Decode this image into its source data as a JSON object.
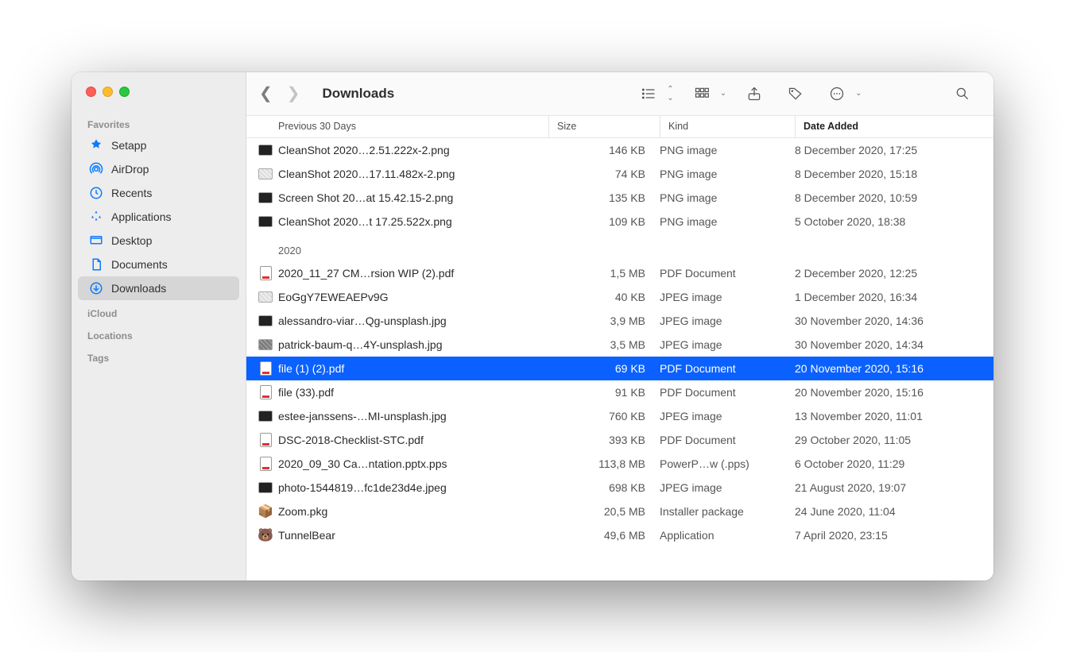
{
  "window": {
    "title": "Downloads"
  },
  "sidebar": {
    "sections": [
      {
        "label": "Favorites",
        "items": [
          {
            "icon": "setapp",
            "label": "Setapp"
          },
          {
            "icon": "airdrop",
            "label": "AirDrop"
          },
          {
            "icon": "recents",
            "label": "Recents"
          },
          {
            "icon": "apps",
            "label": "Applications"
          },
          {
            "icon": "desktop",
            "label": "Desktop"
          },
          {
            "icon": "docs",
            "label": "Documents"
          },
          {
            "icon": "downloads",
            "label": "Downloads",
            "active": true
          }
        ]
      },
      {
        "label": "iCloud",
        "items": []
      },
      {
        "label": "Locations",
        "items": []
      },
      {
        "label": "Tags",
        "items": []
      }
    ]
  },
  "columns": {
    "name": "Previous 30 Days",
    "size": "Size",
    "kind": "Kind",
    "date": "Date Added"
  },
  "groups": [
    {
      "label": null,
      "rows": [
        {
          "icon": "img-dark",
          "name": "CleanShot 2020…2.51.222x-2.png",
          "size": "146 KB",
          "kind": "PNG image",
          "date": "8 December 2020, 17:25"
        },
        {
          "icon": "img-light",
          "name": "CleanShot 2020…17.11.482x-2.png",
          "size": "74 KB",
          "kind": "PNG image",
          "date": "8 December 2020, 15:18"
        },
        {
          "icon": "img-dark",
          "name": "Screen Shot 20…at 15.42.15-2.png",
          "size": "135 KB",
          "kind": "PNG image",
          "date": "8 December 2020, 10:59"
        },
        {
          "icon": "img-dark",
          "name": "CleanShot 2020…t 17.25.522x.png",
          "size": "109 KB",
          "kind": "PNG image",
          "date": "5 October 2020, 18:38"
        }
      ]
    },
    {
      "label": "2020",
      "rows": [
        {
          "icon": "pdf",
          "name": "2020_11_27 CM…rsion WIP (2).pdf",
          "size": "1,5 MB",
          "kind": "PDF Document",
          "date": "2 December 2020, 12:25"
        },
        {
          "icon": "img-light",
          "name": "EoGgY7EWEAEPv9G",
          "size": "40 KB",
          "kind": "JPEG image",
          "date": "1 December 2020, 16:34"
        },
        {
          "icon": "img-dark",
          "name": "alessandro-viar…Qg-unsplash.jpg",
          "size": "3,9 MB",
          "kind": "JPEG image",
          "date": "30 November 2020, 14:36"
        },
        {
          "icon": "img",
          "name": "patrick-baum-q…4Y-unsplash.jpg",
          "size": "3,5 MB",
          "kind": "JPEG image",
          "date": "30 November 2020, 14:34"
        },
        {
          "icon": "pdf",
          "name": "file (1) (2).pdf",
          "size": "69 KB",
          "kind": "PDF Document",
          "date": "20 November 2020, 15:16",
          "selected": true
        },
        {
          "icon": "pdf",
          "name": "file (33).pdf",
          "size": "91 KB",
          "kind": "PDF Document",
          "date": "20 November 2020, 15:16"
        },
        {
          "icon": "img-dark",
          "name": "estee-janssens-…MI-unsplash.jpg",
          "size": "760 KB",
          "kind": "JPEG image",
          "date": "13 November 2020, 11:01"
        },
        {
          "icon": "pdf",
          "name": "DSC-2018-Checklist-STC.pdf",
          "size": "393 KB",
          "kind": "PDF Document",
          "date": "29 October 2020, 11:05"
        },
        {
          "icon": "ppt",
          "name": "2020_09_30 Ca…ntation.pptx.pps",
          "size": "113,8 MB",
          "kind": "PowerP…w (.pps)",
          "date": "6 October 2020, 11:29"
        },
        {
          "icon": "img-dark",
          "name": "photo-1544819…fc1de23d4e.jpeg",
          "size": "698 KB",
          "kind": "JPEG image",
          "date": "21 August 2020, 19:07"
        },
        {
          "icon": "pkg",
          "name": "Zoom.pkg",
          "size": "20,5 MB",
          "kind": "Installer package",
          "date": "24 June 2020, 11:04"
        },
        {
          "icon": "app",
          "name": "TunnelBear",
          "size": "49,6 MB",
          "kind": "Application",
          "date": "7 April 2020, 23:15"
        }
      ]
    }
  ]
}
